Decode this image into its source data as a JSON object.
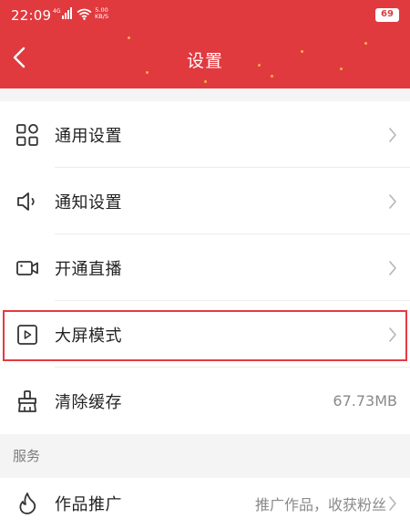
{
  "status_bar": {
    "time": "22:09",
    "signal_icon": "signal-4g-icon",
    "wifi_icon": "wifi-icon",
    "net_speed_value": "5.00",
    "net_speed_unit": "KB/S",
    "battery": "69"
  },
  "header": {
    "title": "设置",
    "back_icon": "chevron-left-icon",
    "background_color": "#e03a3f"
  },
  "settings": {
    "items": [
      {
        "label": "通用设置",
        "icon": "grid-apps-icon",
        "value": "",
        "chevron": true
      },
      {
        "label": "通知设置",
        "icon": "speaker-icon",
        "value": "",
        "chevron": true
      },
      {
        "label": "开通直播",
        "icon": "video-camera-icon",
        "value": "",
        "chevron": true
      },
      {
        "label": "大屏模式",
        "icon": "play-screen-icon",
        "value": "",
        "chevron": true,
        "highlighted": true
      },
      {
        "label": "清除缓存",
        "icon": "broom-icon",
        "value": "67.73MB",
        "chevron": false
      }
    ]
  },
  "services": {
    "header": "服务",
    "items": [
      {
        "label": "作品推广",
        "icon": "flame-icon",
        "value": "推广作品，收获粉丝",
        "chevron": true
      }
    ]
  },
  "colors": {
    "accent": "#e03a3f",
    "highlight_border": "#e53a3f",
    "section_background": "#f4f4f4"
  }
}
